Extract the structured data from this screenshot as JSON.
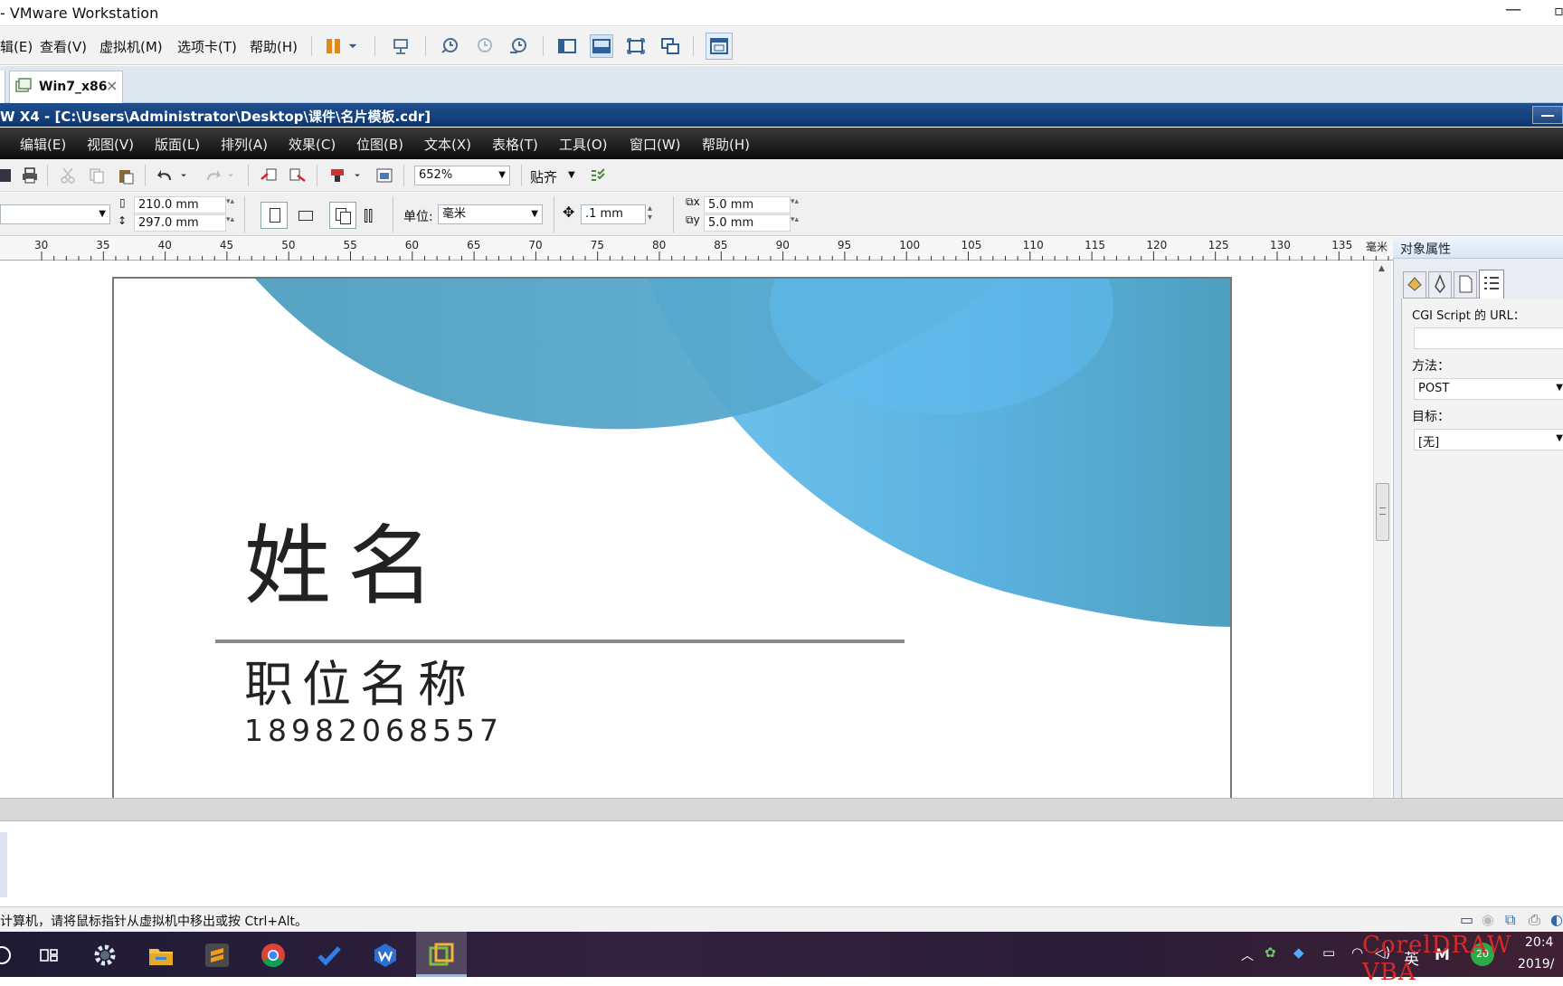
{
  "vm": {
    "title": "- VMware Workstation",
    "menu": [
      "辑(E)",
      "查看(V)",
      "虚拟机(M)",
      "选项卡(T)",
      "帮助(H)"
    ],
    "tab_label": "Win7_x86",
    "status_text": "计算机，请将鼠标指针从虚拟机中移出或按 Ctrl+Alt。"
  },
  "corel": {
    "title": "W X4 - [C:\\Users\\Administrator\\Desktop\\课件\\名片模板.cdr]",
    "menu": [
      "编辑(E)",
      "视图(V)",
      "版面(L)",
      "排列(A)",
      "效果(C)",
      "位图(B)",
      "文本(X)",
      "表格(T)",
      "工具(O)",
      "窗口(W)",
      "帮助(H)"
    ],
    "zoom": "652%",
    "snap_label": "贴齐",
    "page_width": "210.0 mm",
    "page_height": "297.0 mm",
    "unit_label": "单位:",
    "unit_value": "毫米",
    "nudge": ".1 mm",
    "dup_x": "5.0 mm",
    "dup_y": "5.0 mm",
    "ruler_labels": [
      "30",
      "35",
      "40",
      "45",
      "50",
      "55",
      "60",
      "65",
      "70",
      "75",
      "80",
      "85",
      "90",
      "95",
      "100",
      "105",
      "110",
      "115",
      "120",
      "125",
      "130",
      "135"
    ],
    "ruler_unit": "毫米"
  },
  "card": {
    "name": "姓名",
    "position": "职位名称",
    "phone": "18982068557"
  },
  "docker": {
    "title": "对象属性",
    "cgi_label": "CGI Script 的 URL：",
    "cgi_value": "",
    "method_label": "方法：",
    "method_value": "POST",
    "target_label": "目标：",
    "target_value": "[无]"
  },
  "tray": {
    "ime": "英",
    "ime2": "M",
    "badge": "20",
    "time": "20:4",
    "date": "2019/",
    "watermark": "CorelDRAW VBA"
  },
  "colors": {
    "accent_blue": "#5fb6e8",
    "teal_blue": "#4e9cbb",
    "titlebar": "#173f7c"
  }
}
